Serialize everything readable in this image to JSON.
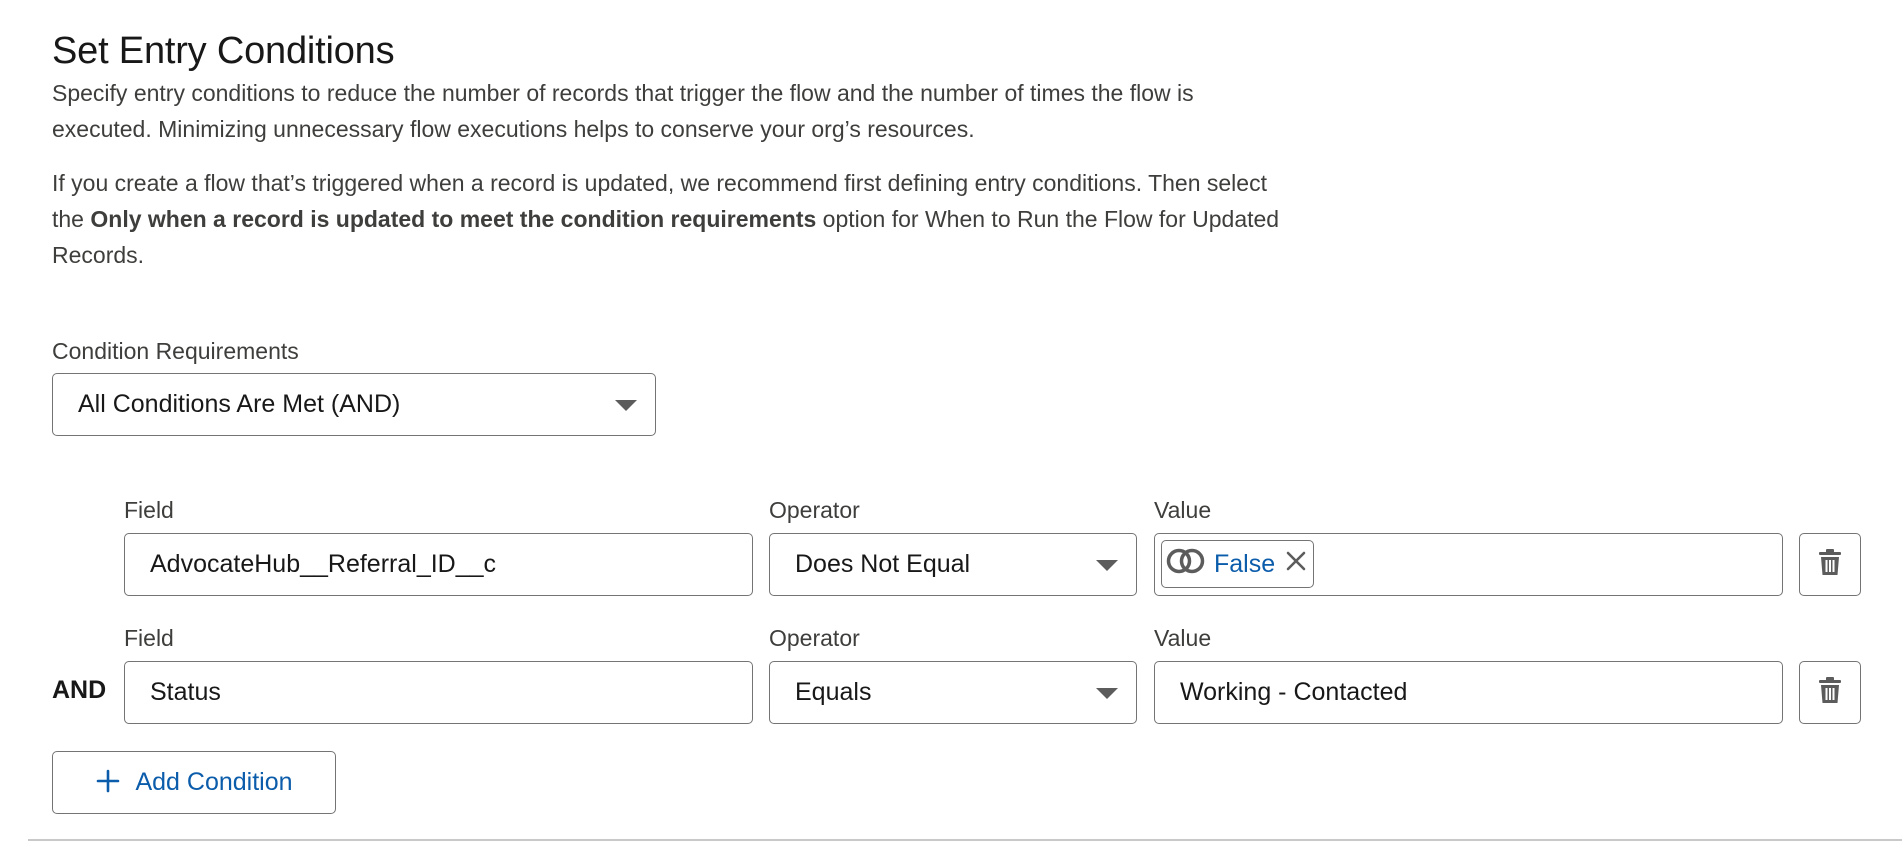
{
  "section": {
    "title": "Set Entry Conditions",
    "para1_line1": "Specify entry conditions to reduce the number of records that trigger the flow and the number of times the flow is",
    "para1_line2": "executed. Minimizing unnecessary flow executions helps to conserve your org’s resources.",
    "para2_line1": "If you create a flow that’s triggered when a record is updated, we recommend first defining entry conditions. Then select",
    "para2_line2_pre": "the ",
    "para2_line2_bold": "Only when a record is updated to meet the condition requirements",
    "para2_line2_post": " option for When to Run the Flow for Updated",
    "para2_line3": "Records."
  },
  "condition_requirements": {
    "label": "Condition Requirements",
    "selected": "All Conditions Are Met (AND)"
  },
  "conditions": [
    {
      "field_label": "Field",
      "field_value": "AdvocateHub__Referral_ID__c",
      "operator_label": "Operator",
      "operator_value": "Does Not Equal",
      "value_label": "Value",
      "value_pill": "False"
    },
    {
      "logic": "AND",
      "field_label": "Field",
      "field_value": "Status",
      "operator_label": "Operator",
      "operator_value": "Equals",
      "value_label": "Value",
      "value_text": "Working - Contacted"
    }
  ],
  "add_condition_label": "Add Condition",
  "icons": {
    "caret": "chevron-down-icon",
    "trash": "trash-icon",
    "boolean": "boolean-resource-icon",
    "remove": "close-icon",
    "add": "plus-icon"
  },
  "colors": {
    "link_blue": "#0b5cab",
    "border": "#747474",
    "text": "#181818"
  }
}
